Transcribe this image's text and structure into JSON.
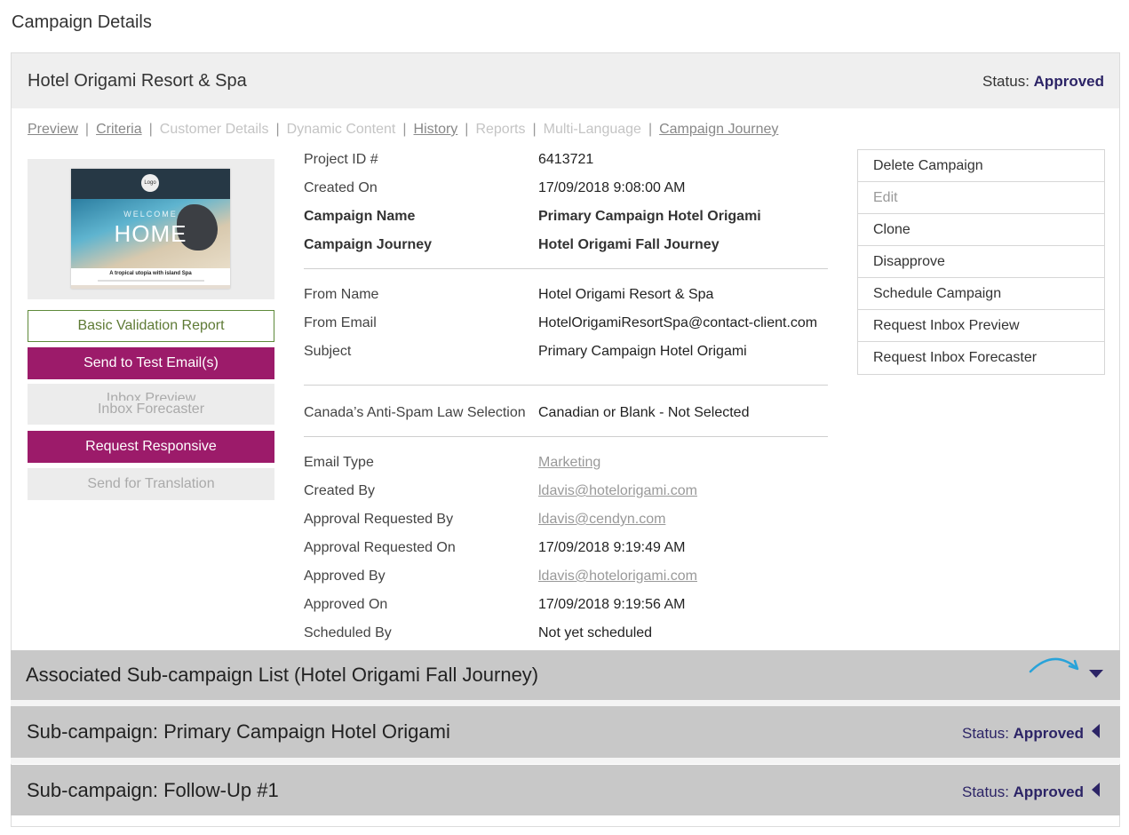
{
  "page": {
    "title": "Campaign Details"
  },
  "campaign": {
    "name": "Hotel Origami Resort & Spa",
    "status_label": "Status:",
    "status_value": "Approved"
  },
  "tabs": [
    {
      "label": "Preview",
      "enabled": true
    },
    {
      "label": "Criteria",
      "enabled": true
    },
    {
      "label": "Customer Details",
      "enabled": false
    },
    {
      "label": "Dynamic Content",
      "enabled": false
    },
    {
      "label": "History",
      "enabled": true
    },
    {
      "label": "Reports",
      "enabled": false
    },
    {
      "label": "Multi-Language",
      "enabled": false
    },
    {
      "label": "Campaign Journey",
      "enabled": true
    }
  ],
  "tab_separator": "|",
  "thumbnail": {
    "logo_text": "Logo",
    "welcome": "WELCOME",
    "home": "HOME",
    "caption": "A tropical utopia with island Spa"
  },
  "left_buttons": {
    "validation": "Basic Validation Report",
    "send_test": "Send to Test Email(s)",
    "inbox_preview": "Inbox Preview",
    "inbox_forecaster": "Inbox Forecaster",
    "request_responsive": "Request Responsive",
    "send_translation": "Send for Translation"
  },
  "details": {
    "group1": [
      {
        "label": "Project ID #",
        "value": "6413721"
      },
      {
        "label": "Created On",
        "value": "17/09/2018 9:08:00 AM"
      },
      {
        "label": "Campaign Name",
        "value": "Primary Campaign Hotel Origami"
      },
      {
        "label": "Campaign Journey",
        "value": "Hotel Origami Fall Journey"
      }
    ],
    "group2": [
      {
        "label": "From Name",
        "value": "Hotel Origami Resort & Spa"
      },
      {
        "label": "From Email",
        "value": "HotelOrigamiResortSpa@contact-client.com"
      },
      {
        "label": "Subject",
        "value": "Primary Campaign Hotel Origami"
      }
    ],
    "group3": [
      {
        "label": "Canada’s Anti-Spam Law Selection",
        "value": "Canadian or Blank - Not Selected"
      }
    ],
    "group4": [
      {
        "label": "Email Type",
        "value": "Marketing"
      },
      {
        "label": "Created By",
        "value": "ldavis@hotelorigami.com"
      },
      {
        "label": "Approval Requested By",
        "value": "ldavis@cendyn.com"
      },
      {
        "label": "Approval Requested On",
        "value": "17/09/2018 9:19:49 AM"
      },
      {
        "label": "Approved By",
        "value": "ldavis@hotelorigami.com"
      },
      {
        "label": "Approved On",
        "value": "17/09/2018 9:19:56 AM"
      },
      {
        "label": "Scheduled By",
        "value": "Not yet scheduled"
      }
    ]
  },
  "actions": [
    {
      "label": "Delete Campaign",
      "enabled": true
    },
    {
      "label": "Edit",
      "enabled": false
    },
    {
      "label": "Clone",
      "enabled": true
    },
    {
      "label": "Disapprove",
      "enabled": true
    },
    {
      "label": "Schedule Campaign",
      "enabled": true
    },
    {
      "label": "Request Inbox Preview",
      "enabled": true
    },
    {
      "label": "Request Inbox Forecaster",
      "enabled": true
    }
  ],
  "sections": {
    "associated": {
      "title": "Associated Sub-campaign List (Hotel Origami Fall Journey)"
    },
    "sub1": {
      "title": "Sub-campaign: Primary Campaign Hotel Origami",
      "status_label": "Status:",
      "status_value": "Approved"
    },
    "sub2": {
      "title": "Sub-campaign: Follow-Up #1",
      "status_label": "Status:",
      "status_value": "Approved"
    }
  },
  "colors": {
    "accent_navy": "#2c2466",
    "magenta_button": "#9c1b6a",
    "validation_green": "#5e8a3a",
    "annotation_arrow": "#29a3d9"
  }
}
